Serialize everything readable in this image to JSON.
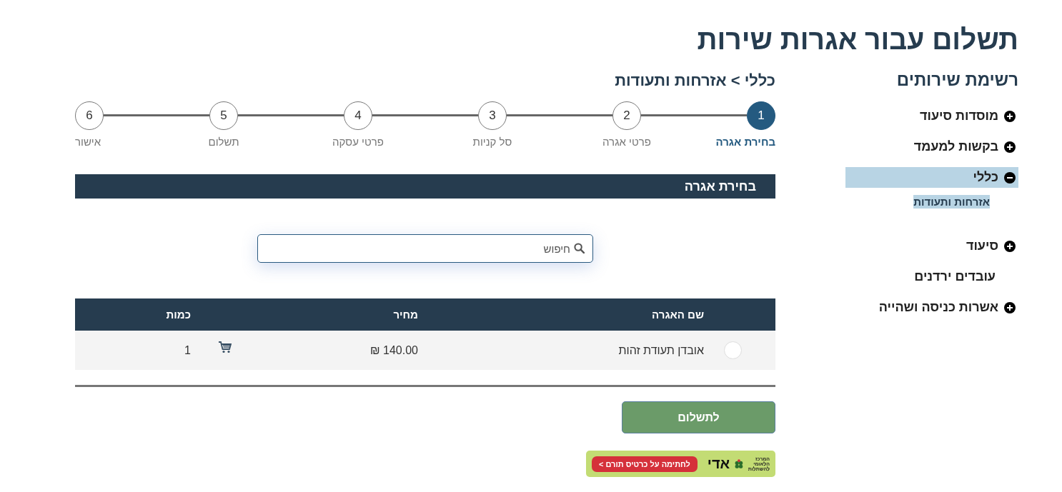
{
  "page_title": "תשלום עבור אגרות שירות",
  "sidebar": {
    "title": "רשימת שירותים",
    "items": [
      {
        "label": "מוסדות סיעוד",
        "expanded": false,
        "selected": false
      },
      {
        "label": "בקשות למעמד",
        "expanded": false,
        "selected": false
      },
      {
        "label": "כללי",
        "expanded": true,
        "selected": true,
        "children": [
          {
            "label": "אזרחות ותעודות",
            "selected": true
          }
        ]
      },
      {
        "label": "סיעוד",
        "expanded": false,
        "selected": false
      },
      {
        "label": "עובדים ירדנים",
        "selected": false
      },
      {
        "label": "אשרות כניסה ושהייה",
        "expanded": false,
        "selected": false
      }
    ]
  },
  "breadcrumb": "כללי > אזרחות ותעודות",
  "steps": [
    {
      "number": "1",
      "label": "בחירת אגרה",
      "selected": true
    },
    {
      "number": "2",
      "label": "פרטי אגרה",
      "selected": false
    },
    {
      "number": "3",
      "label": "סל קניות",
      "selected": false
    },
    {
      "number": "4",
      "label": "פרטי עסקה",
      "selected": false
    },
    {
      "number": "5",
      "label": "תשלום",
      "selected": false
    },
    {
      "number": "6",
      "label": "אישור",
      "selected": false
    }
  ],
  "section_title": "בחירת אגרה",
  "search": {
    "placeholder": "חיפוש"
  },
  "table": {
    "columns": [
      "שם האגרה",
      "מחיר",
      "כמות"
    ],
    "rows": [
      {
        "selected": false,
        "name": "אובדן תעודת זהות",
        "price": "140.00 ₪",
        "quantity": "1"
      }
    ]
  },
  "pay_button": "לתשלום",
  "banner": {
    "org": "המרכז הלאומי להשתלות",
    "brand": "אדי",
    "cta": "לחתימה על כרטיס תורם >"
  }
}
